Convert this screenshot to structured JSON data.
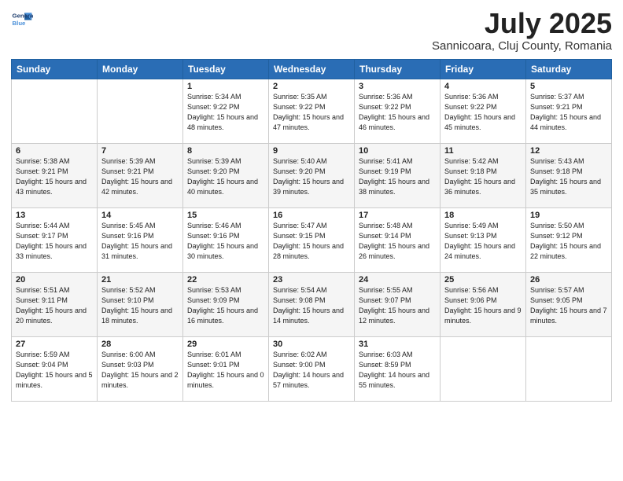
{
  "header": {
    "logo_line1": "General",
    "logo_line2": "Blue",
    "month": "July 2025",
    "location": "Sannicoara, Cluj County, Romania"
  },
  "weekdays": [
    "Sunday",
    "Monday",
    "Tuesday",
    "Wednesday",
    "Thursday",
    "Friday",
    "Saturday"
  ],
  "weeks": [
    [
      {
        "day": "",
        "sunrise": "",
        "sunset": "",
        "daylight": ""
      },
      {
        "day": "",
        "sunrise": "",
        "sunset": "",
        "daylight": ""
      },
      {
        "day": "1",
        "sunrise": "Sunrise: 5:34 AM",
        "sunset": "Sunset: 9:22 PM",
        "daylight": "Daylight: 15 hours and 48 minutes."
      },
      {
        "day": "2",
        "sunrise": "Sunrise: 5:35 AM",
        "sunset": "Sunset: 9:22 PM",
        "daylight": "Daylight: 15 hours and 47 minutes."
      },
      {
        "day": "3",
        "sunrise": "Sunrise: 5:36 AM",
        "sunset": "Sunset: 9:22 PM",
        "daylight": "Daylight: 15 hours and 46 minutes."
      },
      {
        "day": "4",
        "sunrise": "Sunrise: 5:36 AM",
        "sunset": "Sunset: 9:22 PM",
        "daylight": "Daylight: 15 hours and 45 minutes."
      },
      {
        "day": "5",
        "sunrise": "Sunrise: 5:37 AM",
        "sunset": "Sunset: 9:21 PM",
        "daylight": "Daylight: 15 hours and 44 minutes."
      }
    ],
    [
      {
        "day": "6",
        "sunrise": "Sunrise: 5:38 AM",
        "sunset": "Sunset: 9:21 PM",
        "daylight": "Daylight: 15 hours and 43 minutes."
      },
      {
        "day": "7",
        "sunrise": "Sunrise: 5:39 AM",
        "sunset": "Sunset: 9:21 PM",
        "daylight": "Daylight: 15 hours and 42 minutes."
      },
      {
        "day": "8",
        "sunrise": "Sunrise: 5:39 AM",
        "sunset": "Sunset: 9:20 PM",
        "daylight": "Daylight: 15 hours and 40 minutes."
      },
      {
        "day": "9",
        "sunrise": "Sunrise: 5:40 AM",
        "sunset": "Sunset: 9:20 PM",
        "daylight": "Daylight: 15 hours and 39 minutes."
      },
      {
        "day": "10",
        "sunrise": "Sunrise: 5:41 AM",
        "sunset": "Sunset: 9:19 PM",
        "daylight": "Daylight: 15 hours and 38 minutes."
      },
      {
        "day": "11",
        "sunrise": "Sunrise: 5:42 AM",
        "sunset": "Sunset: 9:18 PM",
        "daylight": "Daylight: 15 hours and 36 minutes."
      },
      {
        "day": "12",
        "sunrise": "Sunrise: 5:43 AM",
        "sunset": "Sunset: 9:18 PM",
        "daylight": "Daylight: 15 hours and 35 minutes."
      }
    ],
    [
      {
        "day": "13",
        "sunrise": "Sunrise: 5:44 AM",
        "sunset": "Sunset: 9:17 PM",
        "daylight": "Daylight: 15 hours and 33 minutes."
      },
      {
        "day": "14",
        "sunrise": "Sunrise: 5:45 AM",
        "sunset": "Sunset: 9:16 PM",
        "daylight": "Daylight: 15 hours and 31 minutes."
      },
      {
        "day": "15",
        "sunrise": "Sunrise: 5:46 AM",
        "sunset": "Sunset: 9:16 PM",
        "daylight": "Daylight: 15 hours and 30 minutes."
      },
      {
        "day": "16",
        "sunrise": "Sunrise: 5:47 AM",
        "sunset": "Sunset: 9:15 PM",
        "daylight": "Daylight: 15 hours and 28 minutes."
      },
      {
        "day": "17",
        "sunrise": "Sunrise: 5:48 AM",
        "sunset": "Sunset: 9:14 PM",
        "daylight": "Daylight: 15 hours and 26 minutes."
      },
      {
        "day": "18",
        "sunrise": "Sunrise: 5:49 AM",
        "sunset": "Sunset: 9:13 PM",
        "daylight": "Daylight: 15 hours and 24 minutes."
      },
      {
        "day": "19",
        "sunrise": "Sunrise: 5:50 AM",
        "sunset": "Sunset: 9:12 PM",
        "daylight": "Daylight: 15 hours and 22 minutes."
      }
    ],
    [
      {
        "day": "20",
        "sunrise": "Sunrise: 5:51 AM",
        "sunset": "Sunset: 9:11 PM",
        "daylight": "Daylight: 15 hours and 20 minutes."
      },
      {
        "day": "21",
        "sunrise": "Sunrise: 5:52 AM",
        "sunset": "Sunset: 9:10 PM",
        "daylight": "Daylight: 15 hours and 18 minutes."
      },
      {
        "day": "22",
        "sunrise": "Sunrise: 5:53 AM",
        "sunset": "Sunset: 9:09 PM",
        "daylight": "Daylight: 15 hours and 16 minutes."
      },
      {
        "day": "23",
        "sunrise": "Sunrise: 5:54 AM",
        "sunset": "Sunset: 9:08 PM",
        "daylight": "Daylight: 15 hours and 14 minutes."
      },
      {
        "day": "24",
        "sunrise": "Sunrise: 5:55 AM",
        "sunset": "Sunset: 9:07 PM",
        "daylight": "Daylight: 15 hours and 12 minutes."
      },
      {
        "day": "25",
        "sunrise": "Sunrise: 5:56 AM",
        "sunset": "Sunset: 9:06 PM",
        "daylight": "Daylight: 15 hours and 9 minutes."
      },
      {
        "day": "26",
        "sunrise": "Sunrise: 5:57 AM",
        "sunset": "Sunset: 9:05 PM",
        "daylight": "Daylight: 15 hours and 7 minutes."
      }
    ],
    [
      {
        "day": "27",
        "sunrise": "Sunrise: 5:59 AM",
        "sunset": "Sunset: 9:04 PM",
        "daylight": "Daylight: 15 hours and 5 minutes."
      },
      {
        "day": "28",
        "sunrise": "Sunrise: 6:00 AM",
        "sunset": "Sunset: 9:03 PM",
        "daylight": "Daylight: 15 hours and 2 minutes."
      },
      {
        "day": "29",
        "sunrise": "Sunrise: 6:01 AM",
        "sunset": "Sunset: 9:01 PM",
        "daylight": "Daylight: 15 hours and 0 minutes."
      },
      {
        "day": "30",
        "sunrise": "Sunrise: 6:02 AM",
        "sunset": "Sunset: 9:00 PM",
        "daylight": "Daylight: 14 hours and 57 minutes."
      },
      {
        "day": "31",
        "sunrise": "Sunrise: 6:03 AM",
        "sunset": "Sunset: 8:59 PM",
        "daylight": "Daylight: 14 hours and 55 minutes."
      },
      {
        "day": "",
        "sunrise": "",
        "sunset": "",
        "daylight": ""
      },
      {
        "day": "",
        "sunrise": "",
        "sunset": "",
        "daylight": ""
      }
    ]
  ]
}
